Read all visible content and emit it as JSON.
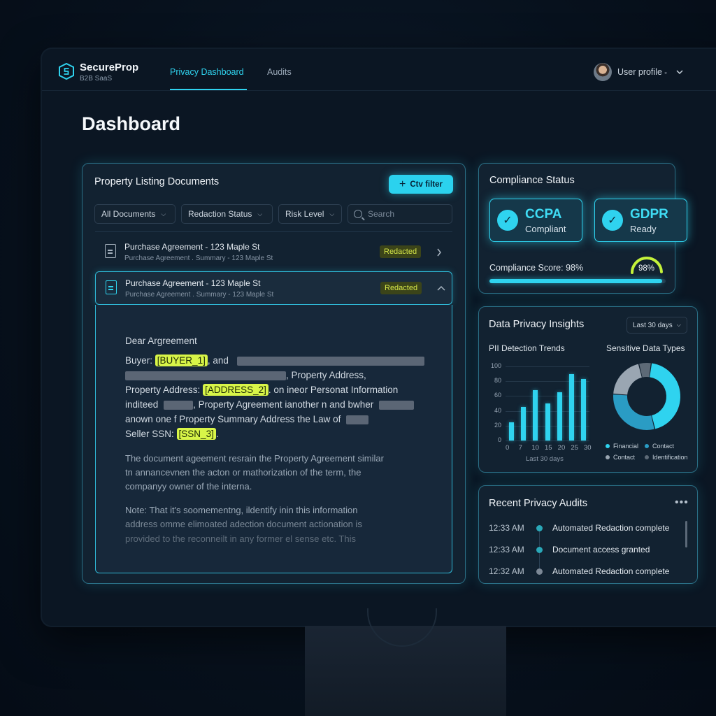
{
  "brand": {
    "name": "SecureProp",
    "tagline": "B2B SaaS"
  },
  "nav": {
    "tabs": [
      {
        "label": "Privacy Dashboard",
        "active": true
      },
      {
        "label": "Audits",
        "active": false
      }
    ]
  },
  "user": {
    "label": "User profile",
    "suffix": "▫"
  },
  "page": {
    "title": "Dashboard"
  },
  "documents": {
    "title": "Property Listing Documents",
    "filter_button": "Ctv filter",
    "filters": [
      "All Documents",
      "Redaction Status",
      "Risk Level"
    ],
    "search_placeholder": "Search",
    "rows": [
      {
        "title": "Purchase Agreement - 123 Maple St",
        "subtitle": "Purchase Agreement . Summary - 123 Maple St",
        "status": "Redacted",
        "expanded": false
      },
      {
        "title": "Purchase Agreement - 123 Maple St",
        "subtitle": "Purchase Agreement . Summary - 123 Maple St",
        "status": "Redacted",
        "expanded": true
      }
    ],
    "preview": {
      "greeting": "Dear Argreement",
      "buyer_label": "Buyer:",
      "buyer_tag": "[BUYER_1]",
      "buyer_after": ", and",
      "line2_after": ", Property Address,",
      "address_label": "Property Address:",
      "address_tag": "[ADDRESS_2]",
      "address_after": ". on ineor Personat Information",
      "line4a": "inditeed",
      "line4b": ", Property Agreement ianother n and bwher",
      "line5": "anown one f Property Summary Address the Law of",
      "ssn_label": "Seller SSN:",
      "ssn_tag": "[SSN_3]",
      "ssn_after": ".",
      "para2": [
        "The document ageement resrain the Property Agreement similar",
        "tn annancevnen the acton or mathorization of the term, the",
        "companyy owner of the interna."
      ],
      "para3": [
        "Note: That it's soomementng, ildentify inin this information",
        "address omme elimoated adection document actionation is",
        "provided to the reconneilt in any former el sense etc. This"
      ]
    }
  },
  "compliance": {
    "title": "Compliance Status",
    "badges": [
      {
        "name": "CCPA",
        "status": "Compliant"
      },
      {
        "name": "GDPR",
        "status": "Ready"
      }
    ],
    "score_label": "Compliance Score: 98%",
    "score_value": 98,
    "score_display": "98%",
    "accent": "#2fd3ef"
  },
  "insights": {
    "title": "Data Privacy Insights",
    "period": "Last 30 days",
    "trend_title": "PII Detection Trends",
    "types_title": "Sensitive Data Types",
    "legend": [
      {
        "label": "Financial",
        "color": "#2fd3ef"
      },
      {
        "label": "Contact",
        "color": "#2a9cc4"
      },
      {
        "label": "Contact",
        "color": "#9aa6b2"
      },
      {
        "label": "Identification",
        "color": "#5d6a77"
      }
    ]
  },
  "chart_data": [
    {
      "type": "bar",
      "title": "PII Detection Trends",
      "xlabel": "Last 30 days",
      "ylabel": "",
      "ylim": [
        0,
        100
      ],
      "yticks": [
        "100",
        "80",
        "60",
        "40",
        "20",
        "0"
      ],
      "xticks": [
        "0",
        "7",
        "10",
        "15",
        "20",
        "25",
        "30"
      ],
      "values": [
        25,
        45,
        68,
        50,
        65,
        90,
        83
      ],
      "color": "#2fd3ef"
    },
    {
      "type": "pie",
      "title": "Sensitive Data Types",
      "categories": [
        "Financial",
        "Contact",
        "Contact",
        "Identification"
      ],
      "values": [
        44,
        30,
        20,
        6
      ],
      "colors": [
        "#2fd3ef",
        "#2a9cc4",
        "#9aa6b2",
        "#5d6a77"
      ]
    }
  ],
  "audits": {
    "title": "Recent Privacy Audits",
    "more": "•••",
    "items": [
      {
        "time": "12:33 AM",
        "text": "Automated Redaction complete",
        "color": "#2aa8b8"
      },
      {
        "time": "12:33 AM",
        "text": "Document access granted",
        "color": "#2aa8b8"
      },
      {
        "time": "12:32 AM",
        "text": "Automated Redaction complete",
        "color": "#7c8896"
      }
    ]
  }
}
